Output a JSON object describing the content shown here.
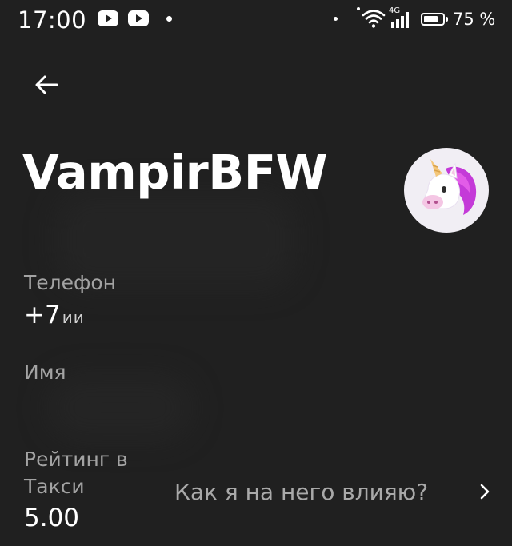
{
  "status_bar": {
    "time": "17:00",
    "network_type": "4G",
    "battery_percent": "75 %",
    "battery_level": 0.75,
    "icons": [
      "youtube-icon",
      "youtube-icon",
      "notification-dot",
      "location-dot",
      "wifi-icon",
      "signal-icon",
      "battery-icon"
    ]
  },
  "header": {
    "back_icon": "arrow-left-icon",
    "title": "VampirBFW",
    "avatar_icon": "unicorn-avatar"
  },
  "fields": {
    "phone_label": "Телефон",
    "phone_value": "+7",
    "phone_masked_suffix": "ии",
    "name_label": "Имя",
    "name_value": "",
    "rating_label": "Рейтинг в\nТакси",
    "rating_value": "5.00"
  },
  "rating_link": {
    "label": "Как я на него влияю?",
    "icon": "chevron-right-icon"
  },
  "colors": {
    "background": "#202020",
    "primary_text": "#ffffff",
    "secondary_text": "#a3a3a3",
    "avatar_bg": "#f1eef4",
    "unicorn_mane": "#c43ad8"
  }
}
